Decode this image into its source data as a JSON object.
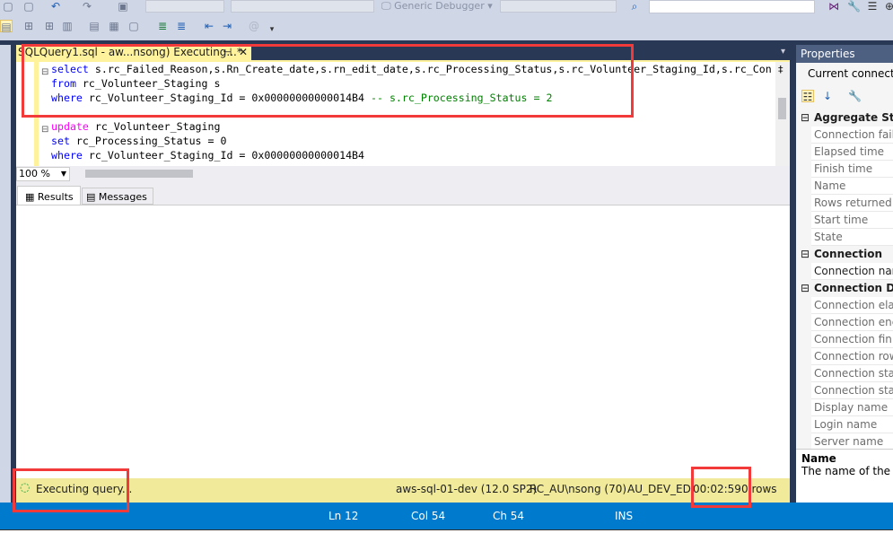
{
  "toolbar": {
    "debugger_label": "Generic Debugger"
  },
  "tab": {
    "title": "SQLQuery1.sql - aw...nsong) Executing...*",
    "pin": "⊣",
    "close": "✕"
  },
  "editor": {
    "lines": [
      [
        {
          "t": "select",
          "c": "kw"
        },
        {
          "t": " s.rc_Failed_Reason,s.Rn_Create_date,s.rn_edit_date,s.rc_Processing_Status,s.rc_Volunteer_Staging_Id,s.rc_Con",
          "c": ""
        }
      ],
      [
        {
          "t": "from",
          "c": "kw"
        },
        {
          "t": " rc_Volunteer_Staging s",
          "c": ""
        }
      ],
      [
        {
          "t": "where",
          "c": "kw"
        },
        {
          "t": " rc_Volunteer_Staging_Id = 0x00000000000014B4 ",
          "c": ""
        },
        {
          "t": "-- s.rc_Processing_Status = 2",
          "c": "cm"
        }
      ],
      [],
      [
        {
          "t": "update",
          "c": "pk"
        },
        {
          "t": " rc_Volunteer_Staging",
          "c": ""
        }
      ],
      [
        {
          "t": "set",
          "c": "kw"
        },
        {
          "t": " rc_Processing_Status = 0",
          "c": ""
        }
      ],
      [
        {
          "t": "where",
          "c": "kw"
        },
        {
          "t": " rc_Volunteer_Staging_Id = 0x00000000000014B4",
          "c": ""
        }
      ]
    ],
    "zoom": "100 %"
  },
  "results_tabs": {
    "results": "Results",
    "messages": "Messages"
  },
  "query_status": {
    "text": "Executing query...",
    "server": "aws-sql-01-dev (12.0 SP2)",
    "user": "RC_AU\\nsong (70)",
    "database": "AU_DEV_ED",
    "elapsed": "00:02:59",
    "rows": "0 rows"
  },
  "statusbar": {
    "ln": "Ln 12",
    "col": "Col 54",
    "ch": "Ch 54",
    "mode": "INS"
  },
  "properties": {
    "title": "Properties",
    "object": "Current connection",
    "categories": [
      {
        "name": "Aggregate Status",
        "items": [
          "Connection failures",
          "Elapsed time",
          "Finish time",
          "Name",
          "Rows returned",
          "Start time",
          "State"
        ]
      },
      {
        "name": "Connection",
        "items": [
          "Connection name"
        ]
      },
      {
        "name": "Connection Details",
        "items": [
          "Connection elapsed time",
          "Connection encryption",
          "Connection finish time",
          "Connection rows returned",
          "Connection start time",
          "Connection state",
          "Display name",
          "Login name",
          "Server name"
        ]
      }
    ],
    "desc_title": "Name",
    "desc_text": "The name of the connection."
  }
}
